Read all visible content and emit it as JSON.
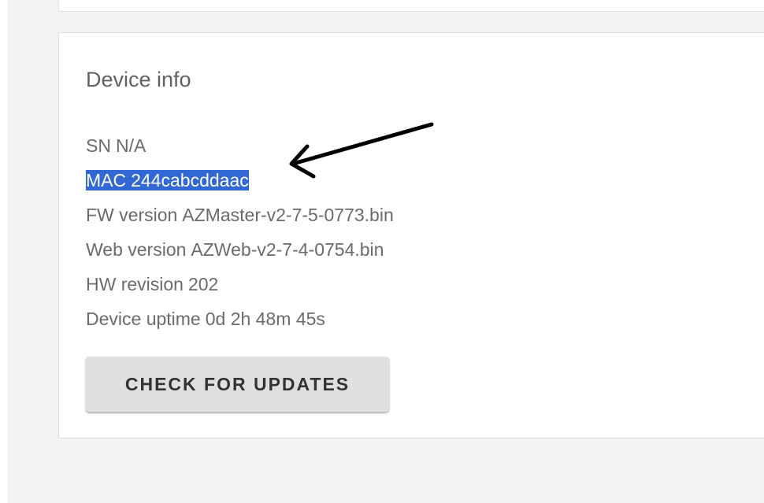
{
  "device_info": {
    "title": "Device info",
    "rows": [
      {
        "label": "SN",
        "value": "N/A"
      },
      {
        "label": "MAC",
        "value": "244cabcddaac"
      },
      {
        "label": "FW version",
        "value": "AZMaster-v2-7-5-0773.bin"
      },
      {
        "label": "Web version",
        "value": "AZWeb-v2-7-4-0754.bin"
      },
      {
        "label": "HW revision",
        "value": "202"
      },
      {
        "label": "Device uptime",
        "value": "0d 2h 48m 45s"
      }
    ],
    "check_updates_label": "CHECK FOR UPDATES"
  },
  "colors": {
    "page_background": "#f3f3f3",
    "card_background": "#ffffff",
    "selection_highlight": "#3267d6",
    "button_background": "#e0e0e0",
    "annotation_arrow": "#000000"
  },
  "annotation": {
    "icon": "arrow-icon",
    "points_to": "MAC"
  }
}
